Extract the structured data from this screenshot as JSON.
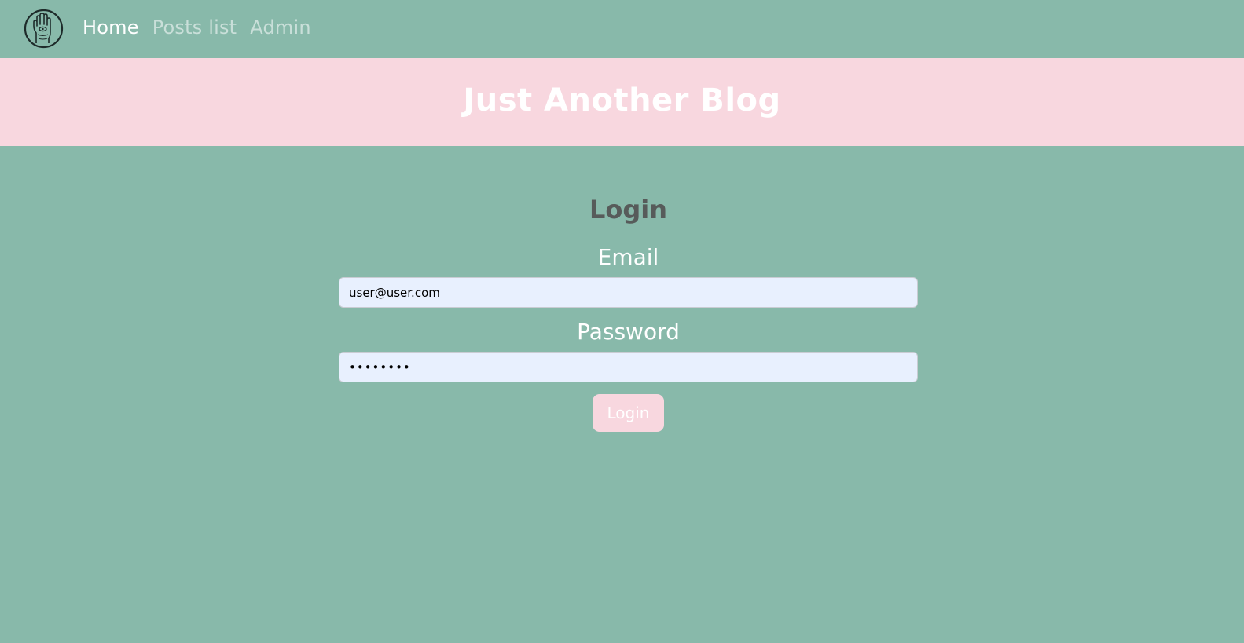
{
  "nav": {
    "logo_icon": "palm-hand-icon",
    "links": [
      {
        "label": "Home",
        "active": true
      },
      {
        "label": "Posts list",
        "active": false
      },
      {
        "label": "Admin",
        "active": false
      }
    ]
  },
  "hero": {
    "title": "Just Another Blog"
  },
  "login": {
    "heading": "Login",
    "email_label": "Email",
    "email_value": "user@user.com",
    "password_label": "Password",
    "password_value": "••••••••",
    "submit_label": "Login"
  },
  "colors": {
    "background": "#88b9aa",
    "accent_pink": "#f8d7df",
    "input_bg": "#e8f0fe",
    "heading_gray": "#575b5a"
  }
}
